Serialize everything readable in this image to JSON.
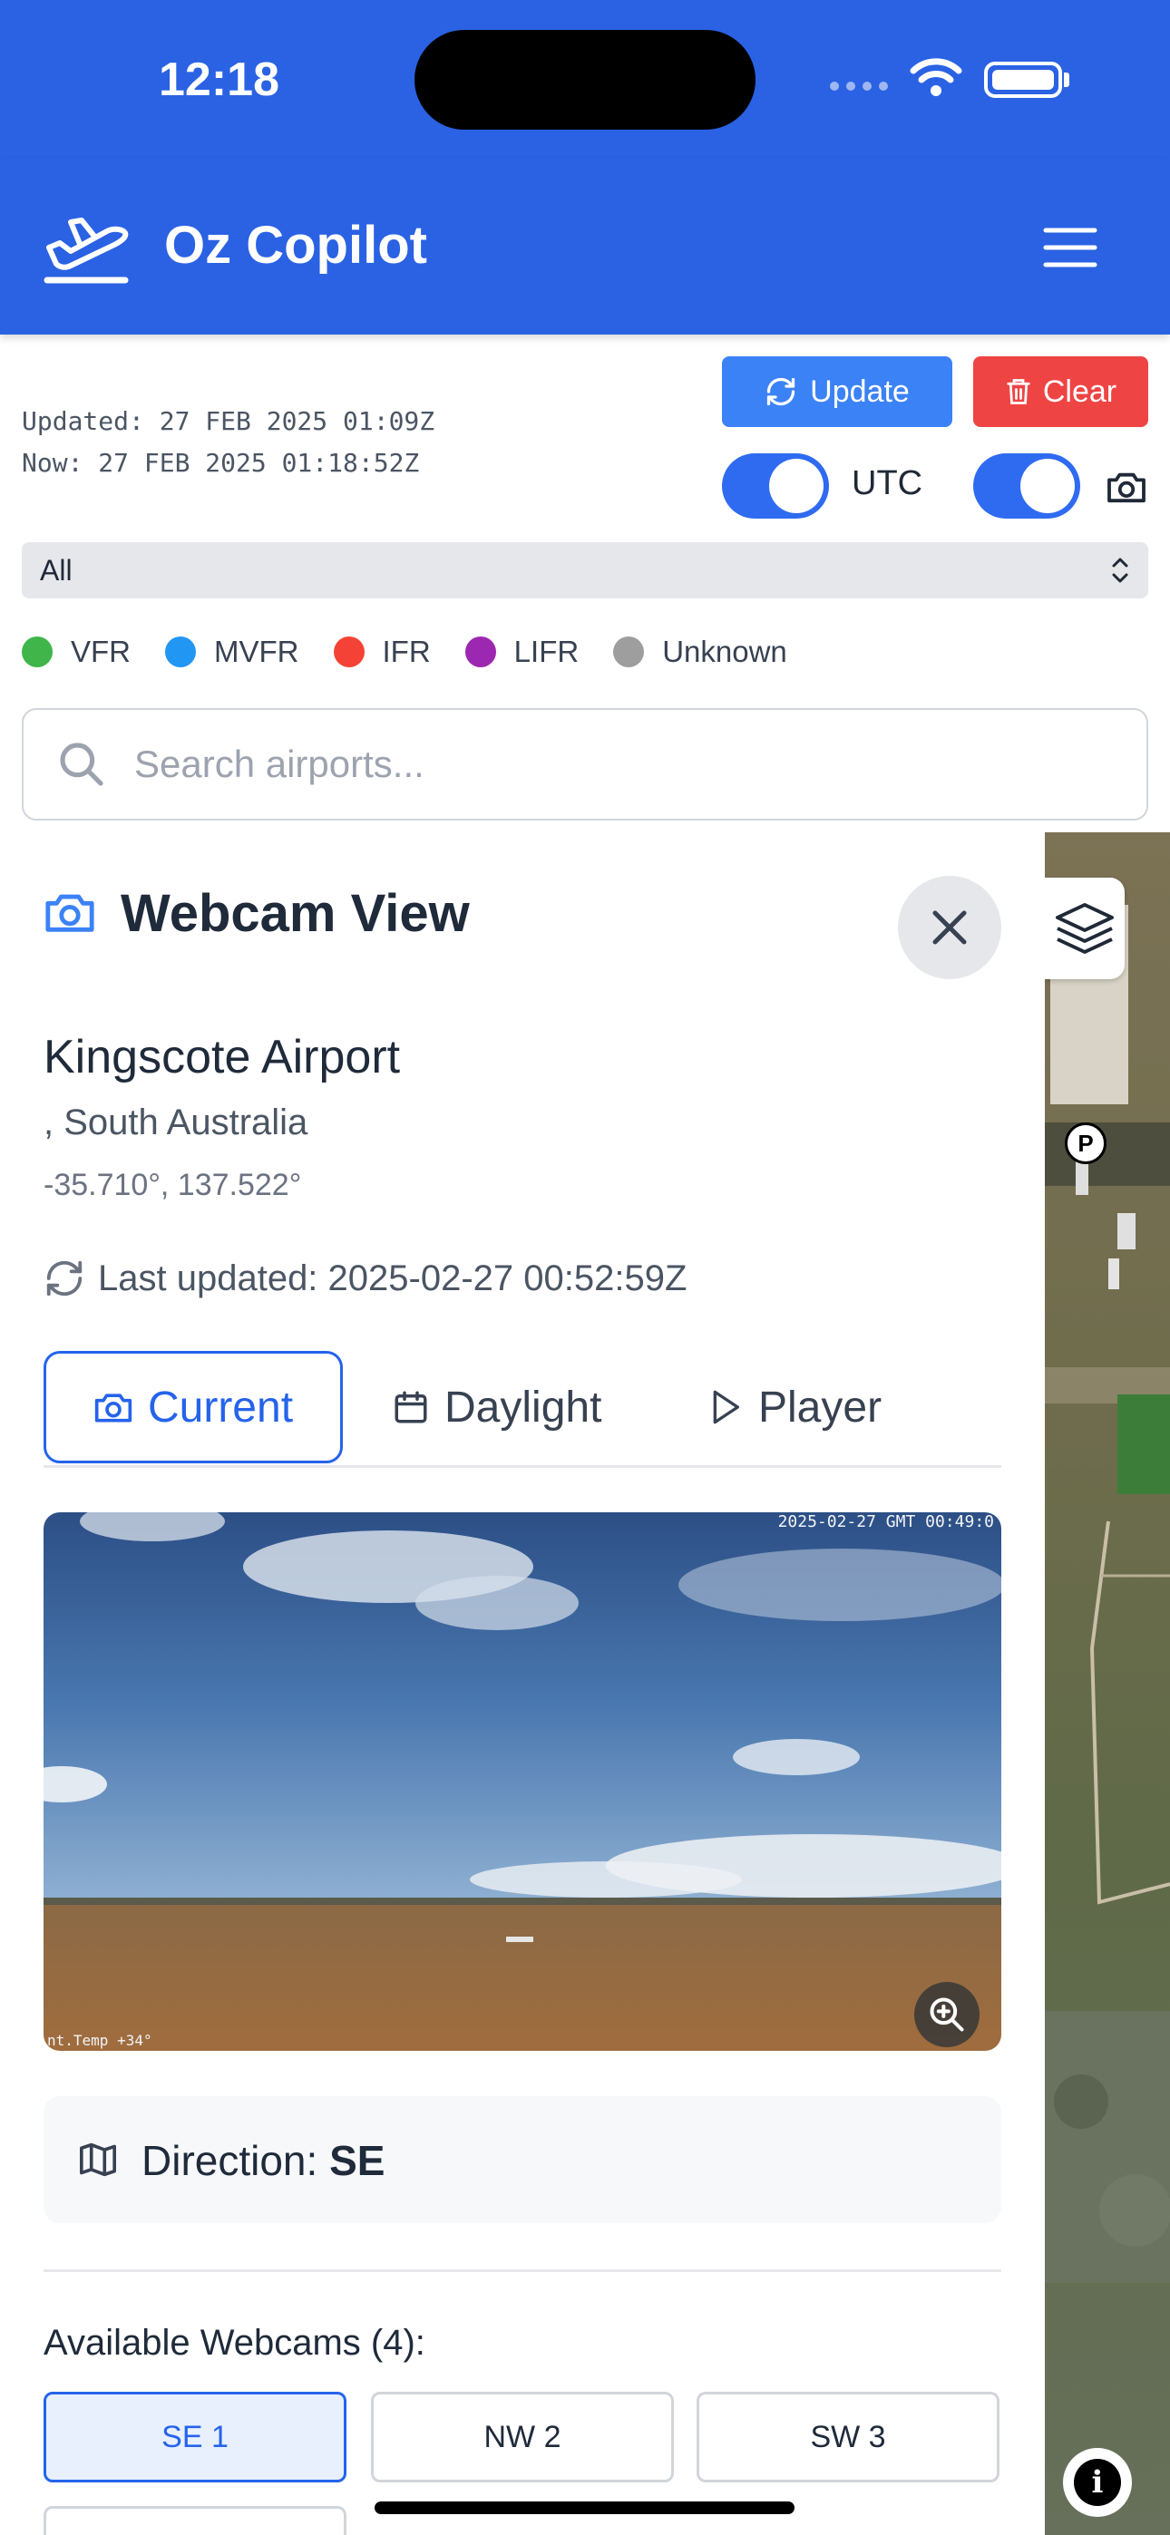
{
  "status_bar": {
    "time": "12:18",
    "icons": [
      "cellular-signal-icon",
      "wifi-icon",
      "battery-icon"
    ]
  },
  "header": {
    "title": "Oz Copilot",
    "logo_icon": "airplane-takeoff-icon",
    "menu_icon": "hamburger-menu-icon"
  },
  "toolbar": {
    "updated_text": "Updated: 27 FEB 2025 01:09Z",
    "now_text": "Now: 27 FEB 2025 01:18:52Z",
    "update_label": "Update",
    "clear_label": "Clear",
    "utc_label": "UTC",
    "utc_enabled": true,
    "webcam_enabled": true
  },
  "filter": {
    "selected": "All"
  },
  "legend": [
    {
      "label": "VFR",
      "color": "#3fb54a"
    },
    {
      "label": "MVFR",
      "color": "#2196f3"
    },
    {
      "label": "IFR",
      "color": "#f44336"
    },
    {
      "label": "LIFR",
      "color": "#9c27b0"
    },
    {
      "label": "Unknown",
      "color": "#9e9e9e"
    }
  ],
  "search": {
    "placeholder": "Search airports..."
  },
  "map": {
    "parking_label": "P",
    "info_label": "i"
  },
  "webcam_panel": {
    "title": "Webcam View",
    "airport_name": "Kingscote Airport",
    "region": ", South Australia",
    "coords": "-35.710°, 137.522°",
    "last_updated": "Last updated: 2025-02-27 00:52:59Z",
    "tabs": [
      {
        "label": "Current",
        "icon": "camera-icon",
        "active": true
      },
      {
        "label": "Daylight",
        "icon": "calendar-icon",
        "active": false
      },
      {
        "label": "Player",
        "icon": "play-icon",
        "active": false
      }
    ],
    "image_timestamp": "2025-02-27 GMT 00:49:0",
    "image_temp": "nt.Temp +34°",
    "direction_label": "Direction:",
    "direction_value": "SE",
    "available_title": "Available Webcams (4):",
    "webcams": [
      {
        "label": "SE 1",
        "active": true
      },
      {
        "label": "NW 2",
        "active": false
      },
      {
        "label": "SW 3",
        "active": false
      }
    ]
  }
}
